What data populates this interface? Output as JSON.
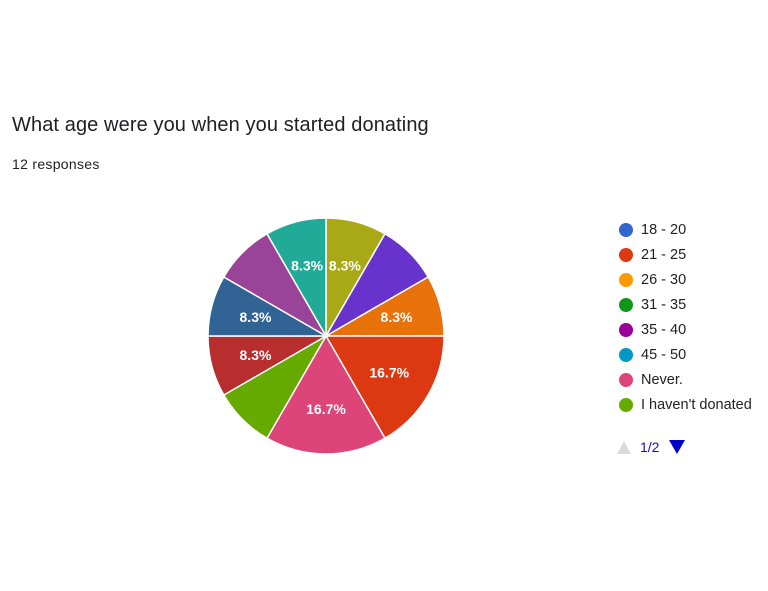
{
  "question": {
    "title": "What age were you when you started donating",
    "responses": "12 responses"
  },
  "chart_data": {
    "type": "pie",
    "title": "What age were you when you started donating",
    "total_responses": 12,
    "slices": [
      {
        "label": "",
        "value": 1,
        "percent_label": "8.3%",
        "color": "#A9A918"
      },
      {
        "label": "",
        "value": 1,
        "percent_label": "",
        "color": "#6733CC"
      },
      {
        "label": "26 - 30",
        "value": 1,
        "percent_label": "8.3%",
        "color": "#E8710A"
      },
      {
        "label": "21 - 25",
        "value": 2,
        "percent_label": "16.7%",
        "color": "#DC3912"
      },
      {
        "label": "Never.",
        "value": 2,
        "percent_label": "16.7%",
        "color": "#DD4477"
      },
      {
        "label": "I haven't donated",
        "value": 1,
        "percent_label": "",
        "color": "#66AA00"
      },
      {
        "label": "",
        "value": 1,
        "percent_label": "8.3%",
        "color": "#B82E2E"
      },
      {
        "label": "",
        "value": 1,
        "percent_label": "8.3%",
        "color": "#316395"
      },
      {
        "label": "",
        "value": 1,
        "percent_label": "",
        "color": "#994499"
      },
      {
        "label": "",
        "value": 1,
        "percent_label": "8.3%",
        "color": "#22AA99"
      }
    ],
    "legend_placement": "right"
  },
  "legend": {
    "items": [
      {
        "label": "18 - 20",
        "color": "#3366CC"
      },
      {
        "label": "21 - 25",
        "color": "#DC3912"
      },
      {
        "label": "26 - 30",
        "color": "#FF9900"
      },
      {
        "label": "31 - 35",
        "color": "#109618"
      },
      {
        "label": "35 - 40",
        "color": "#990099"
      },
      {
        "label": "45 - 50",
        "color": "#0099C6"
      },
      {
        "label": "Never.",
        "color": "#DD4477"
      },
      {
        "label": "I haven't donated",
        "color": "#66AA00"
      }
    ],
    "page_indicator": "1/2"
  }
}
